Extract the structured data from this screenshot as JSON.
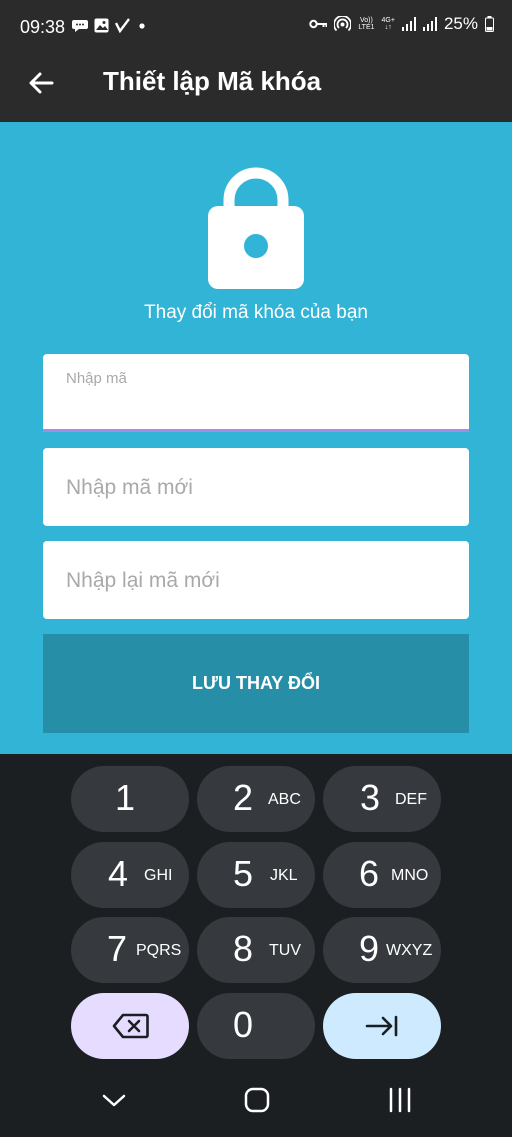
{
  "status_bar": {
    "time": "09:38",
    "battery": "25%",
    "volte_label": "Vo))",
    "lte_label": "LTE1",
    "net_label": "4G+"
  },
  "app_bar": {
    "title": "Thiết lập Mã khóa"
  },
  "main": {
    "subtitle": "Thay đổi mã khóa của bạn",
    "fields": [
      {
        "label": "Nhập mã",
        "value": ""
      },
      {
        "placeholder": "Nhập mã mới"
      },
      {
        "placeholder": "Nhập lại mã mới"
      }
    ],
    "save_label": "LƯU THAY ĐỔI"
  },
  "keyboard": {
    "keys": [
      {
        "num": "1",
        "letters": ""
      },
      {
        "num": "2",
        "letters": "ABC"
      },
      {
        "num": "3",
        "letters": "DEF"
      },
      {
        "num": "4",
        "letters": "GHI"
      },
      {
        "num": "5",
        "letters": "JKL"
      },
      {
        "num": "6",
        "letters": "MNO"
      },
      {
        "num": "7",
        "letters": "PQRS"
      },
      {
        "num": "8",
        "letters": "TUV"
      },
      {
        "num": "9",
        "letters": "WXYZ"
      },
      {
        "num": "0",
        "letters": ""
      }
    ]
  },
  "colors": {
    "primary": "#31b4d6",
    "button": "#278ea8",
    "app_bar": "#2b2b2b",
    "field_underline": "#a78be7"
  },
  "icons": [
    "back-arrow-icon",
    "lock-icon",
    "backspace-icon",
    "next-tab-icon",
    "nav-collapse-icon",
    "nav-home-icon",
    "nav-recents-icon"
  ]
}
